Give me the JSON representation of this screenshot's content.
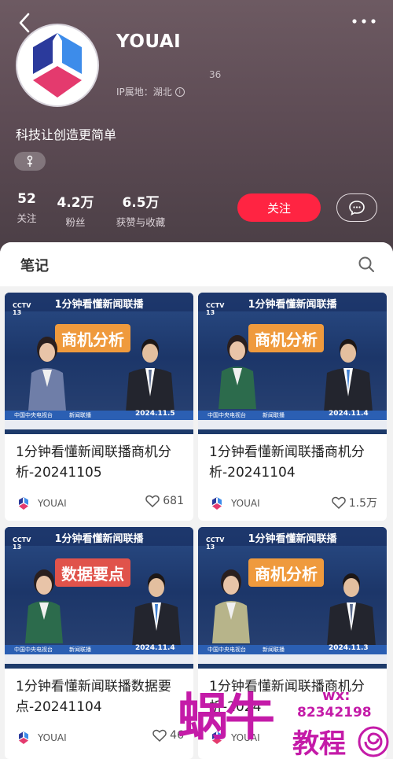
{
  "profile": {
    "nickname": "YOUAI",
    "id_suffix": "36",
    "ip_location": "IP属地：湖北",
    "bio": "科技让创造更简单",
    "stats": [
      {
        "num": "52",
        "label": "关注"
      },
      {
        "num": "4.2万",
        "label": "粉丝"
      },
      {
        "num": "6.5万",
        "label": "获赞与收藏"
      }
    ],
    "follow_label": "关注"
  },
  "notes": {
    "tab_label": "笔记",
    "cards": [
      {
        "header": "1分钟看懂新闻联播",
        "badge": "商机分析",
        "badge_color": "#ef9a3d",
        "date": "2024.11.5",
        "title": "1分钟看懂新闻联播商机分析-20241105",
        "author": "YOUAI",
        "likes": "681"
      },
      {
        "header": "1分钟看懂新闻联播",
        "badge": "商机分析",
        "badge_color": "#ef9a3d",
        "date": "2024.11.4",
        "title": "1分钟看懂新闻联播商机分析-20241104",
        "author": "YOUAI",
        "likes": "1.5万"
      },
      {
        "header": "1分钟看懂新闻联播",
        "badge": "数据要点",
        "badge_color": "#e0534b",
        "date": "2024.11.4",
        "title": "1分钟看懂新闻联播数据要点-20241104",
        "author": "YOUAI",
        "likes": "46"
      },
      {
        "header": "1分钟看懂新闻联播",
        "badge": "商机分析",
        "badge_color": "#ef9a3d",
        "date": "2024.11.3",
        "title": "1分钟看懂新闻联播商机分析-2024",
        "author": "YOUAI",
        "likes": ""
      }
    ],
    "thumb_channel": "中国中央电视台",
    "thumb_program": "新闻联播",
    "thumb_logo": "CCTV 13"
  },
  "watermark": {
    "big": "蜗牛",
    "wx": "wx:",
    "wx_num": "82342198",
    "teach": "教程"
  },
  "colors": {
    "accent": "#ff2442",
    "header_bg": "#5e4c55"
  }
}
